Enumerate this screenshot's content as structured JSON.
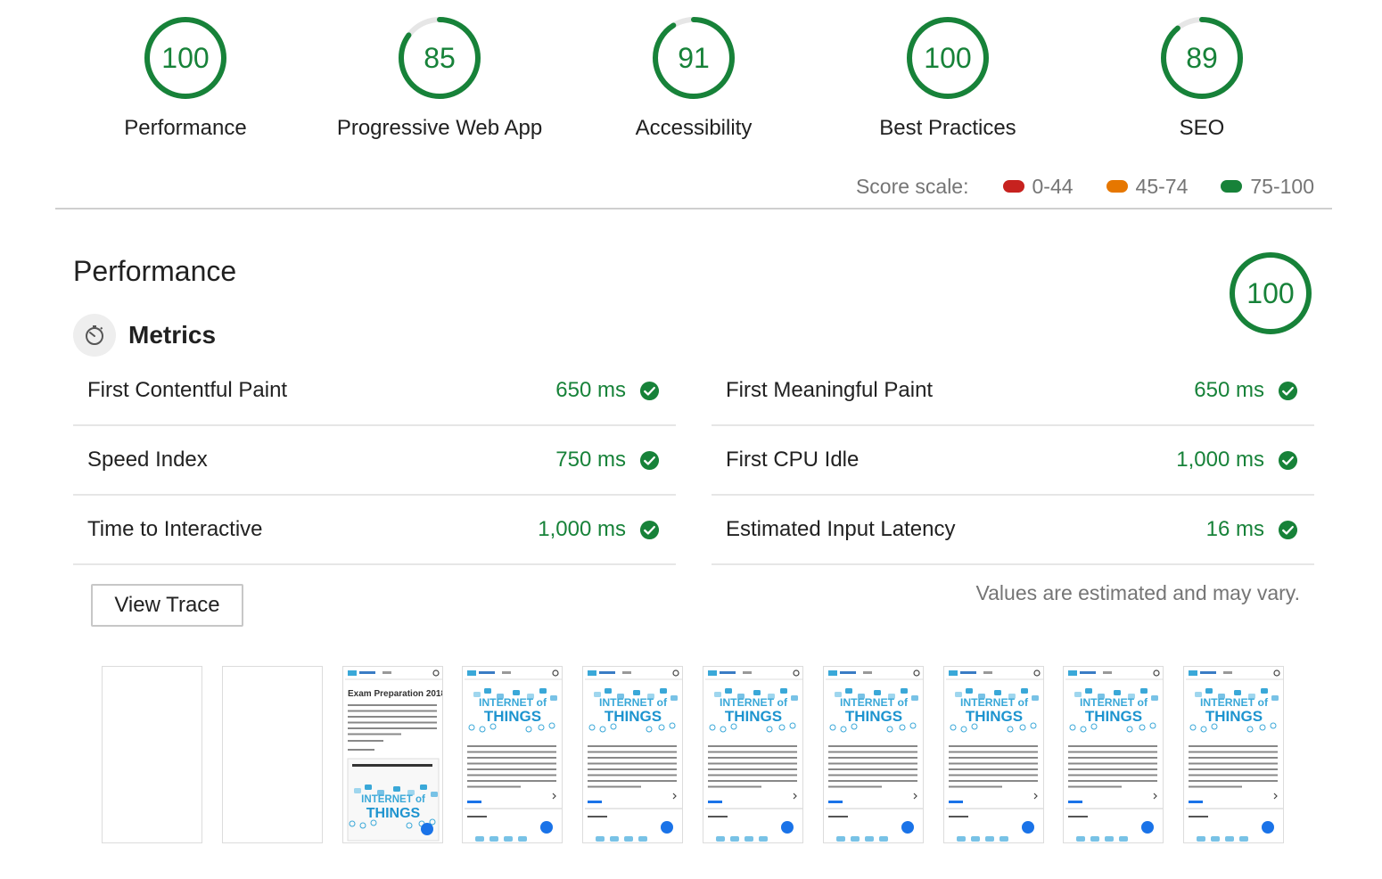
{
  "categories": [
    {
      "score": "100",
      "label": "Performance",
      "fraction": 1.0
    },
    {
      "score": "85",
      "label": "Progressive Web App",
      "fraction": 0.85
    },
    {
      "score": "91",
      "label": "Accessibility",
      "fraction": 0.91
    },
    {
      "score": "100",
      "label": "Best Practices",
      "fraction": 1.0
    },
    {
      "score": "89",
      "label": "SEO",
      "fraction": 0.89
    }
  ],
  "score_scale": {
    "label": "Score scale:",
    "items": [
      {
        "range": "0-44",
        "color": "#c7221f"
      },
      {
        "range": "45-74",
        "color": "#e67700"
      },
      {
        "range": "75-100",
        "color": "#178239"
      }
    ]
  },
  "performance": {
    "title": "Performance",
    "score": "100",
    "metrics_title": "Metrics",
    "metrics": [
      {
        "name": "First Contentful Paint",
        "value": "650 ms"
      },
      {
        "name": "First Meaningful Paint",
        "value": "650 ms"
      },
      {
        "name": "Speed Index",
        "value": "750 ms"
      },
      {
        "name": "First CPU Idle",
        "value": "1,000 ms"
      },
      {
        "name": "Time to Interactive",
        "value": "1,000 ms"
      },
      {
        "name": "Estimated Input Latency",
        "value": "16 ms"
      }
    ],
    "view_trace_label": "View Trace",
    "note": "Values are estimated and may vary."
  },
  "filmstrip": {
    "frames": [
      "blank",
      "blank",
      "exam-page",
      "iot-page",
      "iot-page",
      "iot-page",
      "iot-page",
      "iot-page",
      "iot-page",
      "iot-page"
    ],
    "exam_heading": "Exam Preparation 2018",
    "iot_word1": "INTERNET of",
    "iot_word2": "THINGS"
  },
  "colors": {
    "pass": "#178239",
    "track": "#e6e6e6"
  }
}
